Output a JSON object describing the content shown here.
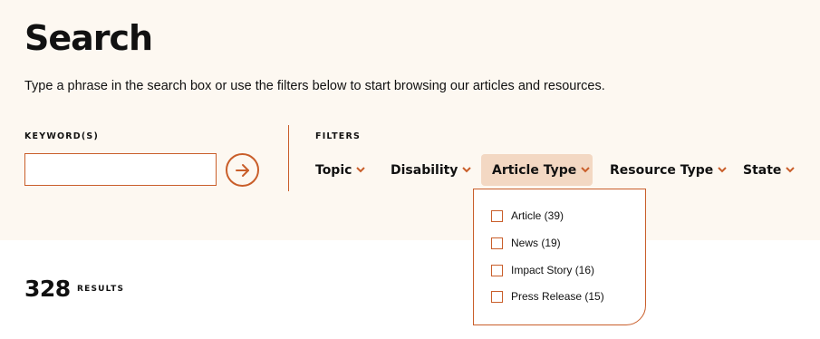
{
  "page": {
    "title": "Search",
    "intro": "Type a phrase in the search box or use the filters below to start browsing our articles and resources."
  },
  "keyword": {
    "label": "KEYWORD(S)",
    "value": "",
    "submit_icon": "arrow-right-circle-icon"
  },
  "filters": {
    "label": "FILTERS",
    "items": [
      {
        "label": "Topic",
        "icon": "chevron-down-icon"
      },
      {
        "label": "Disability",
        "icon": "chevron-down-icon"
      },
      {
        "label": "Article Type",
        "icon": "chevron-down-icon",
        "active": true
      },
      {
        "label": "Resource Type",
        "icon": "chevron-down-icon"
      },
      {
        "label": "State",
        "icon": "chevron-down-icon"
      }
    ]
  },
  "article_type_dropdown": {
    "options": [
      {
        "label": "Article (39)",
        "checked": false
      },
      {
        "label": "News (19)",
        "checked": false
      },
      {
        "label": "Impact Story (16)",
        "checked": false
      },
      {
        "label": "Press Release (15)",
        "checked": false
      }
    ]
  },
  "results": {
    "count": "328",
    "label": "RESULTS"
  },
  "colors": {
    "accent": "#c95e2a",
    "hero_background": "#fdf8f1",
    "active_filter_background": "#f3d8c3"
  }
}
